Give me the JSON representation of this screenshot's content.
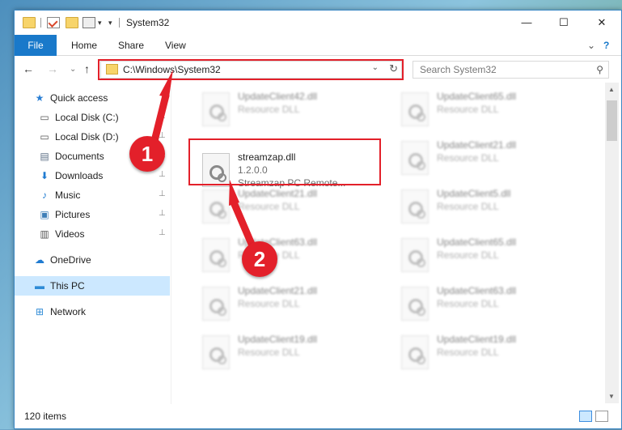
{
  "window": {
    "title": "System32",
    "minimize": "—",
    "maximize": "☐",
    "close": "✕"
  },
  "ribbon": {
    "file": "File",
    "home": "Home",
    "share": "Share",
    "view": "View",
    "expand": "⌄",
    "help": "?"
  },
  "nav": {
    "back": "←",
    "forward": "→",
    "recent": "⌄",
    "up": "↑",
    "address": "C:\\Windows\\System32",
    "address_dropdown": "⌄",
    "refresh": "↻",
    "search_placeholder": "Search System32",
    "search_icon": "⚲"
  },
  "sidebar": {
    "items": [
      {
        "label": "Quick access",
        "icon": "star-icon",
        "glyph": "★",
        "color": "#2a7fd4"
      },
      {
        "label": "Local Disk (C:)",
        "icon": "drive-icon",
        "glyph": "▭",
        "color": "#555555"
      },
      {
        "label": "Local Disk (D:)",
        "icon": "drive-icon",
        "glyph": "▭",
        "color": "#555555"
      },
      {
        "label": "Documents",
        "icon": "documents-icon",
        "glyph": "▤",
        "color": "#5c6f86"
      },
      {
        "label": "Downloads",
        "icon": "download-icon",
        "glyph": "⬇",
        "color": "#1f7bd1"
      },
      {
        "label": "Music",
        "icon": "music-icon",
        "glyph": "♪",
        "color": "#1f7bd1"
      },
      {
        "label": "Pictures",
        "icon": "pictures-icon",
        "glyph": "▣",
        "color": "#3f7fb8"
      },
      {
        "label": "Videos",
        "icon": "videos-icon",
        "glyph": "▥",
        "color": "#555555"
      },
      {
        "label": "OneDrive",
        "icon": "onedrive-icon",
        "glyph": "☁",
        "color": "#1f7bd1"
      },
      {
        "label": "This PC",
        "icon": "computer-icon",
        "glyph": "▬",
        "color": "#2e8bd6"
      },
      {
        "label": "Network",
        "icon": "network-icon",
        "glyph": "⊞",
        "color": "#2e8bd6"
      }
    ],
    "pin": "📌"
  },
  "files": {
    "left": [
      {
        "name": "UpdateClient42.dll",
        "type": "Resource DLL"
      },
      {
        "name": "streamzap.dll",
        "version": "1.2.0.0",
        "desc": "Streamzap PC Remote..."
      },
      {
        "name": "UpdateClient21.dll",
        "type": "Resource DLL"
      },
      {
        "name": "UpdateClient63.dll",
        "type": "Resource DLL"
      },
      {
        "name": "UpdateClient21.dll",
        "type": "Resource DLL"
      },
      {
        "name": "UpdateClient19.dll",
        "type": "Resource DLL"
      }
    ],
    "right": [
      {
        "name": "UpdateClient65.dll",
        "type": "Resource DLL"
      },
      {
        "name": "UpdateClient21.dll",
        "type": "Resource DLL"
      },
      {
        "name": "UpdateClient5.dll",
        "type": "Resource DLL"
      },
      {
        "name": "UpdateClient65.dll",
        "type": "Resource DLL"
      },
      {
        "name": "UpdateClient63.dll",
        "type": "Resource DLL"
      },
      {
        "name": "UpdateClient19.dll",
        "type": "Resource DLL"
      }
    ]
  },
  "status": {
    "count": "120 items"
  },
  "annotations": {
    "marker_1": "1",
    "marker_2": "2",
    "color": "#e3202a"
  }
}
